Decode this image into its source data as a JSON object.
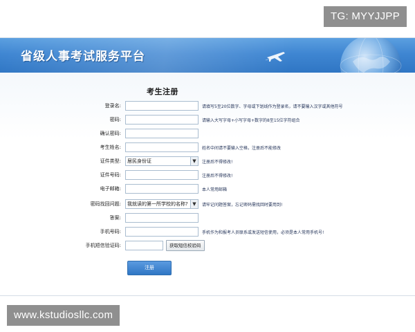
{
  "watermarks": {
    "top": "TG: MYYJJPP",
    "bottom": "www.kstudiosllc.com"
  },
  "header": {
    "title": "省级人事考试服务平台"
  },
  "form": {
    "title": "考生注册",
    "fields": [
      {
        "label": "登录名:",
        "hint": "请填写5至20位数字、字母或下划线作为登录名，请不要输入汉字或其他符号"
      },
      {
        "label": "密码:",
        "hint": "请输入大写字母+小写字母+数字的8至15位字符组合"
      },
      {
        "label": "确认密码:",
        "hint": ""
      },
      {
        "label": "考生姓名:",
        "hint": "姓名中间请不要输入空格，注册后不能修改"
      },
      {
        "label": "证件类型:",
        "value": "居民身份证",
        "hint": "注册后不得修改!"
      },
      {
        "label": "证件号码:",
        "hint": "注册后不得修改!"
      },
      {
        "label": "电子邮箱:",
        "hint": "本人常用邮箱"
      },
      {
        "label": "密码找回问题:",
        "value": "我就读的第一所学校的名称?",
        "hint": "请牢记问题答案，忘记密码需找回时要用到!"
      },
      {
        "label": "答案:",
        "hint": ""
      },
      {
        "label": "手机号码:",
        "hint": "手机作为和报考人员联系或发送短信使用，必须是本人常用手机号!"
      },
      {
        "label": "手机短信验证码:",
        "button": "获取短信校验码"
      }
    ],
    "submit_label": "注册"
  },
  "icons": {
    "header_left": "plane-icon",
    "header_right": "globe-icon",
    "select_arrow": "chevron-down-icon"
  },
  "colors": {
    "banner": "#3f86d2",
    "button": "#2f76c4",
    "watermark": "#8f8f8f"
  }
}
